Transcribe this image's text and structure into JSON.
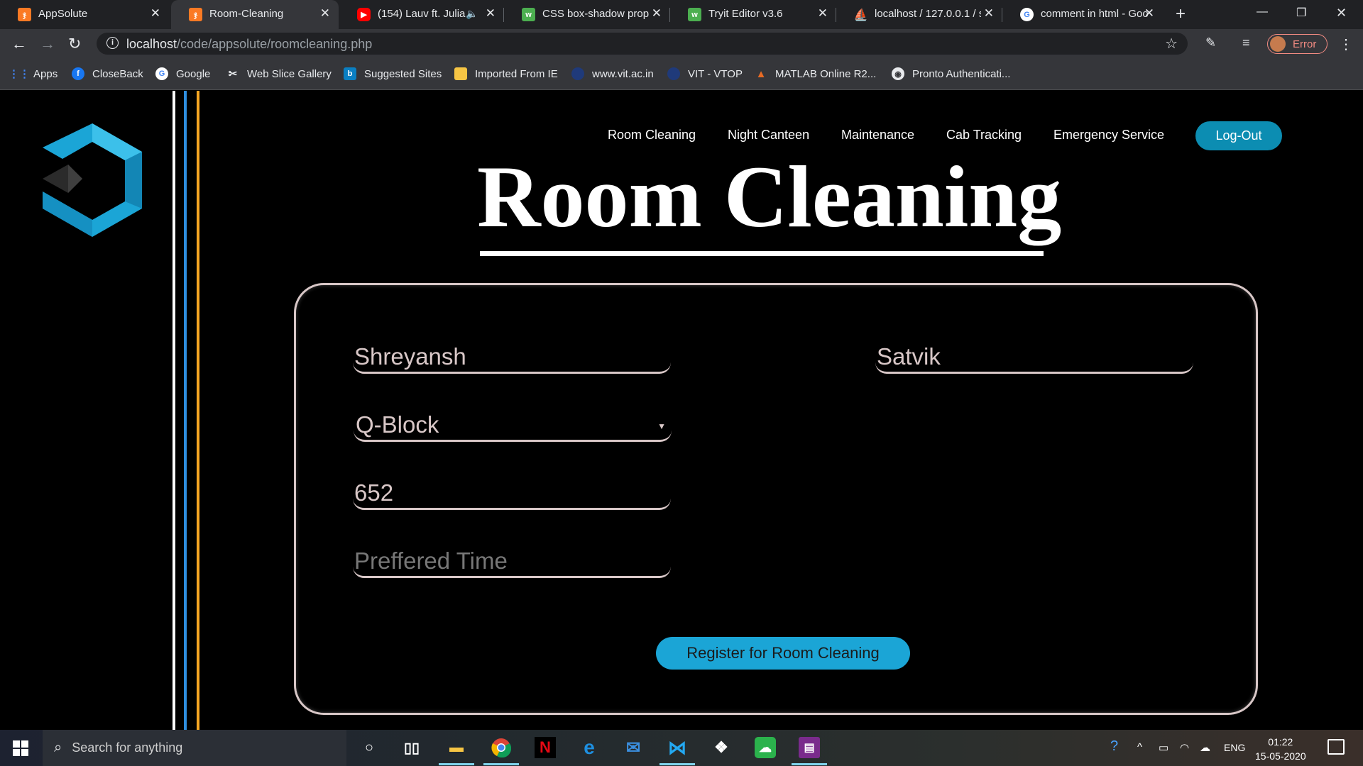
{
  "browser": {
    "tabs": [
      {
        "title": "AppSolute",
        "favicon": "xampp-icon",
        "favicon_color": "#fb7a24"
      },
      {
        "title": "Room-Cleaning",
        "favicon": "xampp-icon",
        "favicon_color": "#fb7a24",
        "active": true
      },
      {
        "title": "(154) Lauv ft. Julia",
        "favicon": "youtube-icon",
        "favicon_color": "#ff0000",
        "audio": true
      },
      {
        "title": "CSS box-shadow prope",
        "favicon": "w3schools-icon",
        "favicon_color": "#4caf50"
      },
      {
        "title": "Tryit Editor v3.6",
        "favicon": "w3schools-icon",
        "favicon_color": "#4caf50"
      },
      {
        "title": "localhost / 127.0.0.1 / s",
        "favicon": "phpmyadmin-icon",
        "favicon_color": "#f39c12"
      },
      {
        "title": "comment in html - Goo",
        "favicon": "google-icon",
        "favicon_color": "#4285f4"
      }
    ],
    "url_host": "localhost",
    "url_path": "/code/appsolute/roomcleaning.php",
    "profile_label": "Error",
    "bookmarks": [
      {
        "label": "Apps",
        "icon": "apps-grid-icon"
      },
      {
        "label": "CloseBack",
        "icon": "facebook-icon"
      },
      {
        "label": "Google",
        "icon": "google-icon"
      },
      {
        "label": "Web Slice Gallery",
        "icon": "web-slice-icon"
      },
      {
        "label": "Suggested Sites",
        "icon": "bing-icon"
      },
      {
        "label": "Imported From IE",
        "icon": "folder-icon"
      },
      {
        "label": "www.vit.ac.in",
        "icon": "vit-icon"
      },
      {
        "label": "VIT - VTOP",
        "icon": "vit-icon"
      },
      {
        "label": "MATLAB Online R2...",
        "icon": "matlab-icon"
      },
      {
        "label": "Pronto Authenticati...",
        "icon": "globe-icon"
      }
    ]
  },
  "page": {
    "nav": [
      "Room Cleaning",
      "Night Canteen",
      "Maintenance",
      "Cab Tracking",
      "Emergency Service"
    ],
    "logout_label": "Log-Out",
    "title": "Room Cleaning",
    "form": {
      "first_name": "Shreyansh",
      "last_name": "Satvik",
      "block": "Q-Block",
      "room": "652",
      "time_placeholder": "Preffered Time",
      "submit_label": "Register for Room Cleaning"
    },
    "colors": {
      "accent": "#1ba5d6",
      "line_blue": "#2f8fe0",
      "line_orange": "#f5a623"
    }
  },
  "taskbar": {
    "search_placeholder": "Search for anything",
    "apps": [
      "cortana-icon",
      "task-view-icon",
      "file-explorer-icon",
      "chrome-icon",
      "netflix-icon",
      "edge-icon",
      "mail-icon",
      "vscode-icon",
      "dropbox-icon",
      "cloud-download-icon",
      "winrar-icon"
    ],
    "language": "ENG",
    "time": "01:22",
    "date": "15-05-2020"
  }
}
